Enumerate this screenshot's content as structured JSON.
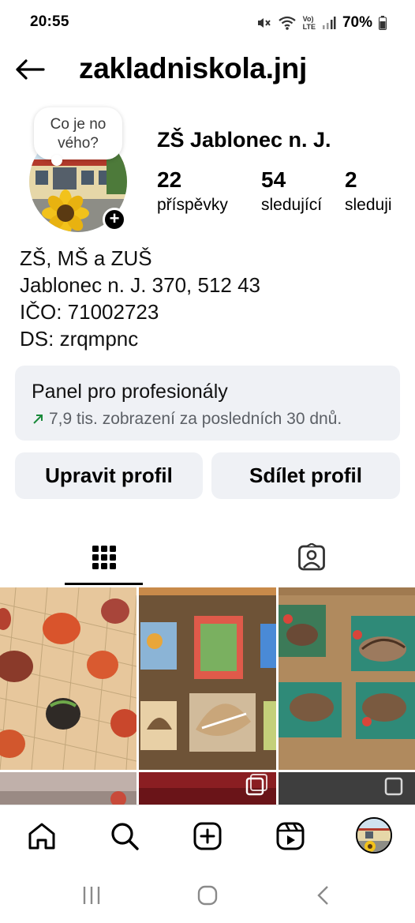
{
  "status_bar": {
    "time": "20:55",
    "battery": "70%",
    "lte_top": "Vo)",
    "lte_bottom": "LTE"
  },
  "header": {
    "username": "zakladniskola.jnj"
  },
  "profile": {
    "note": "Co je no\nvého?",
    "display_name": "ZŠ Jablonec n. J.",
    "stats": [
      {
        "value": "22",
        "label": "příspěvky"
      },
      {
        "value": "54",
        "label": "sledující"
      },
      {
        "value": "2",
        "label": "sleduji"
      }
    ],
    "bio_lines": [
      "ZŠ, MŠ a ZUŠ",
      "Jablonec n. J. 370, 512 43",
      "IČO: 71002723",
      "DS: zrqmpnc"
    ]
  },
  "pro_panel": {
    "title": "Panel pro profesionály",
    "subtitle": "7,9 tis. zobrazení za posledních 30 dnů."
  },
  "buttons": {
    "edit": "Upravit profil",
    "share": "Sdílet profil"
  },
  "tabs": [
    {
      "icon": "grid-icon",
      "active": true
    },
    {
      "icon": "tagged-person-icon",
      "active": false
    }
  ],
  "bottom_nav": [
    "home-icon",
    "search-icon",
    "create-icon",
    "reels-icon",
    "profile-avatar"
  ],
  "colors": {
    "panel_bg": "#eff1f5",
    "muted_text": "#5c6066",
    "growth_arrow": "#1a8a3a",
    "notification_dot": "#ff3040"
  }
}
